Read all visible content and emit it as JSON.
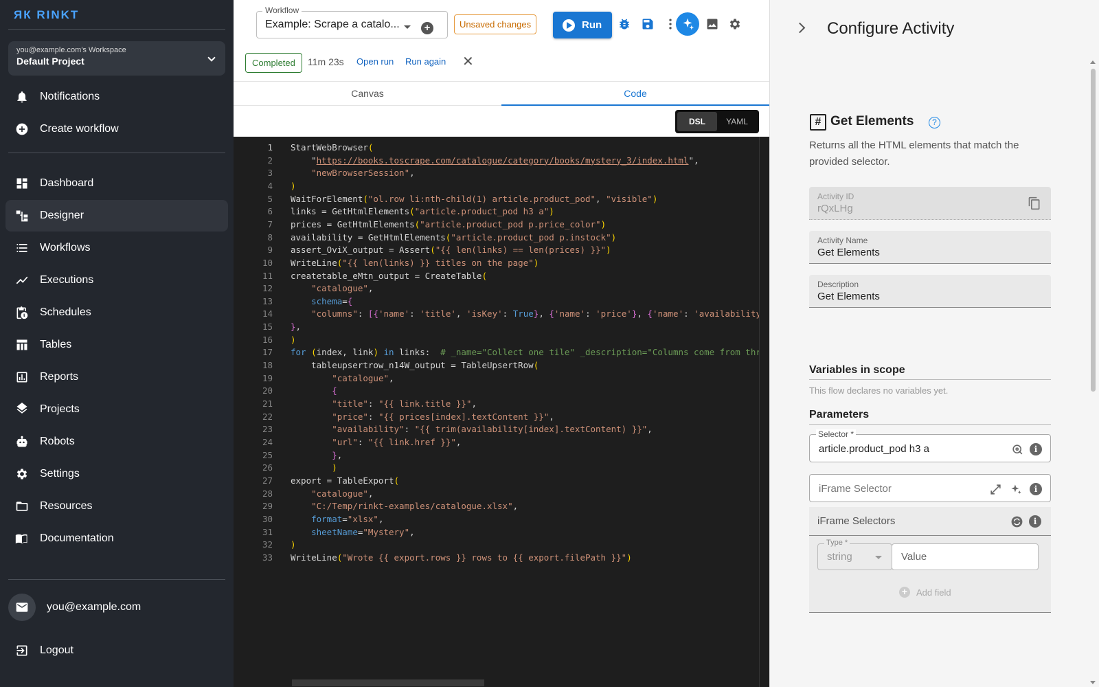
{
  "sidebar": {
    "logo": "ЯК RINKT",
    "workspace_sub": "you@example.com's Workspace",
    "workspace_title": "Default Project",
    "top_items": [
      {
        "label": "Notifications",
        "icon": "bell-icon"
      },
      {
        "label": "Create workflow",
        "icon": "plus-circle-icon"
      }
    ],
    "items": [
      {
        "label": "Dashboard",
        "icon": "dashboard-icon"
      },
      {
        "label": "Designer",
        "icon": "designer-icon",
        "active": true
      },
      {
        "label": "Workflows",
        "icon": "list-icon"
      },
      {
        "label": "Executions",
        "icon": "trend-icon"
      },
      {
        "label": "Schedules",
        "icon": "clipboard-clock-icon"
      },
      {
        "label": "Tables",
        "icon": "table-icon"
      },
      {
        "label": "Reports",
        "icon": "report-icon"
      },
      {
        "label": "Projects",
        "icon": "layers-icon"
      },
      {
        "label": "Robots",
        "icon": "robot-icon"
      },
      {
        "label": "Settings",
        "icon": "gear-icon"
      },
      {
        "label": "Resources",
        "icon": "folder-icon"
      },
      {
        "label": "Documentation",
        "icon": "book-icon"
      }
    ],
    "user_email": "you@example.com",
    "logout_label": "Logout"
  },
  "toolbar": {
    "workflow_label": "Workflow",
    "workflow_value": "Example: Scrape a catalo...",
    "unsaved_label": "Unsaved changes",
    "run_label": "Run",
    "status_label": "Completed",
    "duration": "11m 23s",
    "open_run_label": "Open run",
    "run_again_label": "Run again"
  },
  "tabs": [
    {
      "label": "Canvas",
      "active": false
    },
    {
      "label": "Code",
      "active": true
    }
  ],
  "format_toggle": {
    "dsl": "DSL",
    "yaml": "YAML",
    "active": "DSL"
  },
  "code_lines": [
    "StartWebBrowser(",
    "    \"https://books.toscrape.com/catalogue/category/books/mystery_3/index.html\",",
    "    \"newBrowserSession\",",
    ")",
    "WaitForElement(\"ol.row li:nth-child(1) article.product_pod\", \"visible\")",
    "links = GetHtmlElements(\"article.product_pod h3 a\")",
    "prices = GetHtmlElements(\"article.product_pod p.price_color\")",
    "availability = GetHtmlElements(\"article.product_pod p.instock\")",
    "assert_OviX_output = Assert(\"{{ len(links) == len(prices) }}\")",
    "WriteLine(\"{{ len(links) }} titles on the page\")",
    "createtable_eMtn_output = CreateTable(",
    "    \"catalogue\",",
    "    schema={",
    "    \"columns\": [{'name': 'title', 'isKey': True}, {'name': 'price'}, {'name': 'availability",
    "},",
    ")",
    "for (index, link) in links:  # _name=\"Collect one tile\" _description=\"Columns come from thr",
    "    tableupsertrow_n14W_output = TableUpsertRow(",
    "        \"catalogue\",",
    "        {",
    "        \"title\": \"{{ link.title }}\",",
    "        \"price\": \"{{ prices[index].textContent }}\",",
    "        \"availability\": \"{{ trim(availability[index].textContent) }}\",",
    "        \"url\": \"{{ link.href }}\",",
    "        },",
    "        )",
    "export = TableExport(",
    "    \"catalogue\",",
    "    \"C:/Temp/rinkt-examples/catalogue.xlsx\",",
    "    format=\"xlsx\",",
    "    sheetName=\"Mystery\",",
    ")",
    "WriteLine(\"Wrote {{ export.rows }} rows to {{ export.filePath }}\")"
  ],
  "panel": {
    "title": "Configure Activity",
    "activity_icon": "#",
    "activity_title": "Get Elements",
    "activity_desc": "Returns all the HTML elements that match the provided selector.",
    "activity_id_label": "Activity ID",
    "activity_id_value": "rQxLHg",
    "activity_name_label": "Activity Name",
    "activity_name_value": "Get Elements",
    "description_label": "Description",
    "description_value": "Get Elements",
    "variables_heading": "Variables in scope",
    "variables_empty": "This flow declares no variables yet.",
    "parameters_heading": "Parameters",
    "selector_label": "Selector *",
    "selector_value": "article.product_pod h3 a",
    "iframe_selector_placeholder": "iFrame Selector",
    "iframe_selectors_title": "iFrame Selectors",
    "type_label": "Type *",
    "type_value": "string",
    "value_placeholder": "Value",
    "add_field_label": "Add field"
  }
}
